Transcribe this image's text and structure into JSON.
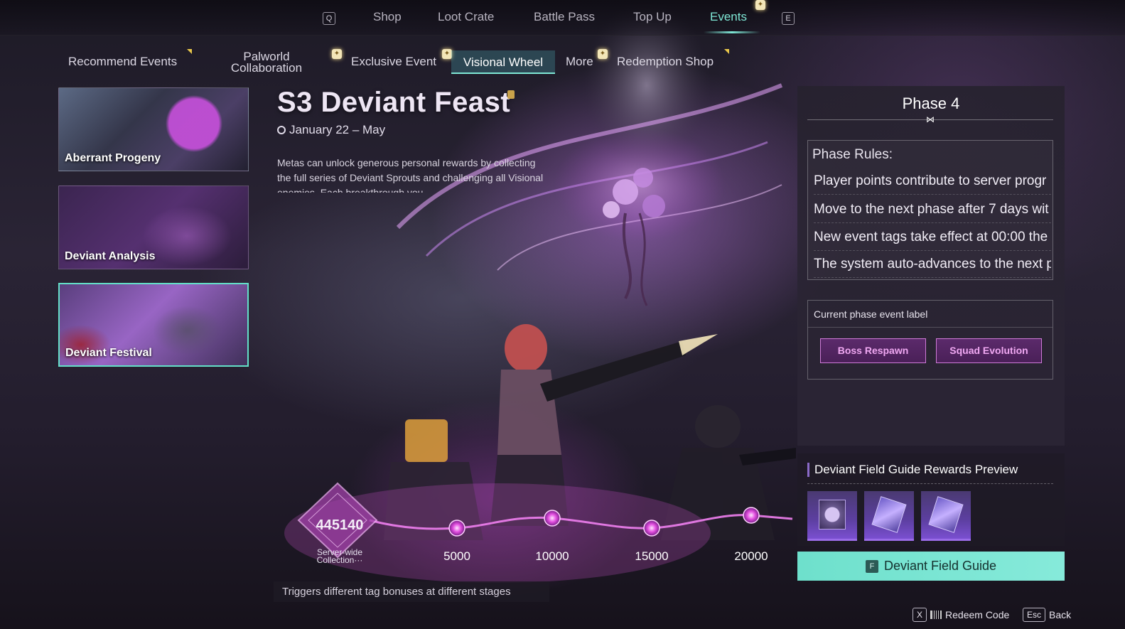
{
  "topnav": {
    "left_key": "Q",
    "right_key": "E",
    "tabs": [
      "Shop",
      "Loot Crate",
      "Battle Pass",
      "Top Up",
      "Events"
    ],
    "active_tab": "Events"
  },
  "subnav": {
    "tabs": [
      "Recommend Events",
      "Palworld Collaboration",
      "Exclusive Event",
      "Visional Wheel",
      "More",
      "Redemption Shop"
    ],
    "active_tab": "Visional Wheel"
  },
  "event_cards": [
    {
      "label": "Aberrant Progeny"
    },
    {
      "label": "Deviant Analysis"
    },
    {
      "label": "Deviant Festival",
      "selected": true
    }
  ],
  "event": {
    "title": "S3 Deviant Feast",
    "date": "January 22 – May",
    "description": "Metas can unlock generous personal rewards by collecting the full series of Deviant Sprouts and challenging all Visional enemies. Each breakthrough you"
  },
  "phase": {
    "title": "Phase 4",
    "rules_header": "Phase Rules:",
    "rules": [
      "Player points contribute to server progr",
      "Move to the next phase after 7 days wit",
      "New event tags take effect at 00:00 the",
      "The system auto-advances to the next p"
    ],
    "label_header": "Current phase event label",
    "tags": [
      "Boss Respawn",
      "Squad Evolution"
    ]
  },
  "rewards": {
    "title": "Deviant Field Guide Rewards Preview",
    "button_key": "F",
    "button_label": "Deviant Field Guide"
  },
  "progress": {
    "server_total": "445140",
    "server_label": "Server-wide Collection···",
    "milestones": [
      "5000",
      "10000",
      "15000",
      "20000"
    ],
    "hint": "Triggers different tag bonuses at different stages"
  },
  "bottom": {
    "redeem_key": "X",
    "redeem_label": "Redeem Code",
    "back_key": "Esc",
    "back_label": "Back"
  },
  "colors": {
    "accent": "#7fe8d6",
    "tag_border": "#cf7ad8",
    "tag_text": "#f0a8f2"
  }
}
